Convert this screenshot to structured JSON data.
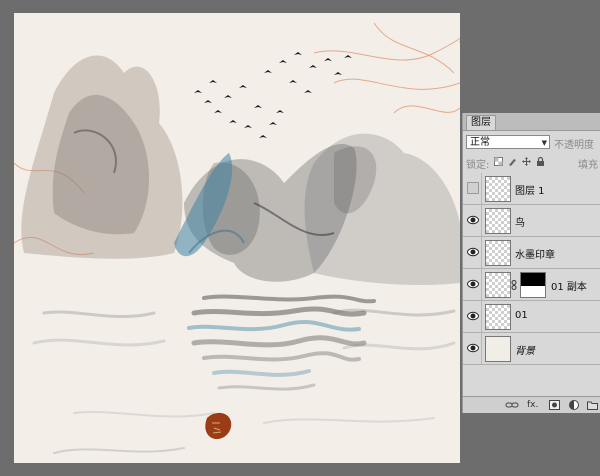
{
  "canvas": {
    "background": "#f3eee8",
    "ink_color": "#3a3a3a",
    "teal_ink": "#3f84a2",
    "orange_ink": "#d8703f",
    "seal_color": "#9a3d17"
  },
  "layers_panel": {
    "tab_label": "图层",
    "blend_mode": "正常",
    "opacity_label": "不透明度",
    "lock_label": "锁定:",
    "fill_label": "填充",
    "layers": [
      {
        "name": "图层 1",
        "visible": false,
        "thumb": "transparent",
        "has_mask": false
      },
      {
        "name": "鸟",
        "visible": true,
        "thumb": "transparent",
        "has_mask": false
      },
      {
        "name": "水墨印章",
        "visible": true,
        "thumb": "transparent",
        "has_mask": false
      },
      {
        "name": "01 副本",
        "visible": true,
        "thumb": "transparent",
        "has_mask": true
      },
      {
        "name": "01",
        "visible": true,
        "thumb": "transparent",
        "has_mask": false
      },
      {
        "name": "背景",
        "visible": true,
        "thumb": "solid",
        "has_mask": false
      }
    ],
    "footer_icons": [
      "link-layers-icon",
      "fx-icon",
      "add-mask-icon",
      "adjustment-layer-icon",
      "new-group-icon"
    ],
    "footer_fx_label": "fx."
  }
}
